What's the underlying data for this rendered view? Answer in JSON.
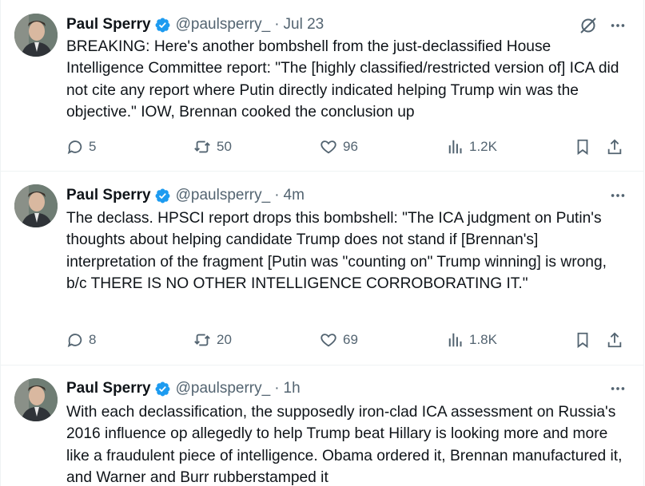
{
  "colors": {
    "text": "#0f1419",
    "secondary": "#536471",
    "verified": "#1d9bf0",
    "divider": "#eff3f4"
  },
  "tweets": [
    {
      "name": "Paul Sperry",
      "handle": "@paulsperry_",
      "dot": "·",
      "time": "Jul 23",
      "text": "BREAKING: Here's another bombshell from the just-declassified House Intelligence Committee report: \"The [highly classified/restricted version of] ICA did not cite any report where Putin directly indicated helping Trump win was the objective.\" IOW, Brennan cooked the conclusion up",
      "replies": "5",
      "reposts": "50",
      "likes": "96",
      "views": "1.2K"
    },
    {
      "name": "Paul Sperry",
      "handle": "@paulsperry_",
      "dot": "·",
      "time": "4m",
      "text": "The declass. HPSCI report drops this bombshell: \"The ICA judgment on Putin's thoughts about helping candidate Trump does not stand if [Brennan's] interpretation of the fragment [Putin was \"counting on\" Trump winning] is wrong, b/c THERE IS NO OTHER INTELLIGENCE CORROBORATING IT.\"",
      "replies": "8",
      "reposts": "20",
      "likes": "69",
      "views": "1.8K"
    },
    {
      "name": "Paul Sperry",
      "handle": "@paulsperry_",
      "dot": "·",
      "time": "1h",
      "text": "With each declassification, the supposedly iron-clad ICA assessment on Russia's 2016 influence op allegedly to help Trump beat Hillary is looking more and more like a fraudulent piece of intelligence. Obama ordered it, Brennan manufactured it, and Warner and Burr rubberstamped it"
    }
  ]
}
